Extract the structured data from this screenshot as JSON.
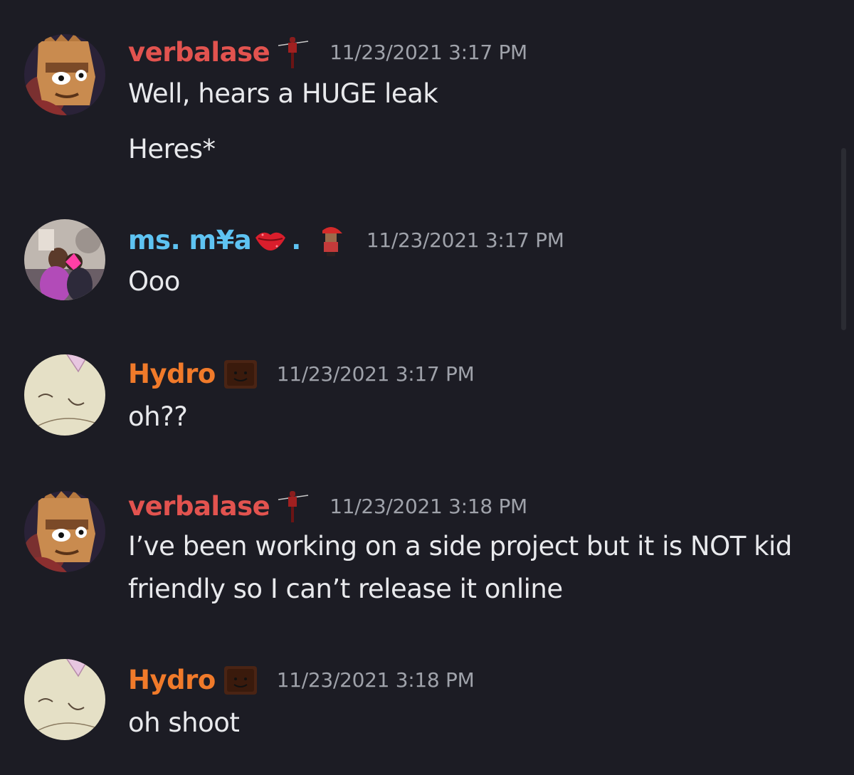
{
  "colors": {
    "background": "#1c1c24",
    "verbalase": "#e2534f",
    "mya": "#5ec3f2",
    "hydro": "#f07a2a",
    "message_text": "#e8e9ec",
    "timestamp": "#9fa2aa"
  },
  "messages": [
    {
      "username": "verbalase",
      "badges": [
        "scarecrow-badge-icon"
      ],
      "timestamp": "11/23/2021 3:17 PM",
      "lines": [
        "Well, hears a HUGE leak",
        "Heres*"
      ]
    },
    {
      "username": "ms. m¥a",
      "username_suffix": ".",
      "badges": [
        "lips-emoji-icon",
        "red-cap-character-icon"
      ],
      "timestamp": "11/23/2021 3:17 PM",
      "lines": [
        "Ooo"
      ]
    },
    {
      "username": "Hydro",
      "badges": [
        "smiling-box-icon"
      ],
      "timestamp": "11/23/2021 3:17 PM",
      "lines": [
        "oh??"
      ]
    },
    {
      "username": "verbalase",
      "badges": [
        "scarecrow-badge-icon"
      ],
      "timestamp": "11/23/2021 3:18 PM",
      "lines": [
        "I’ve been working on a side project but it is NOT kid",
        "friendly so I can’t release it online"
      ]
    },
    {
      "username": "Hydro",
      "badges": [
        "smiling-box-icon"
      ],
      "timestamp": "11/23/2021 3:18 PM",
      "lines": [
        "oh shoot"
      ]
    }
  ]
}
